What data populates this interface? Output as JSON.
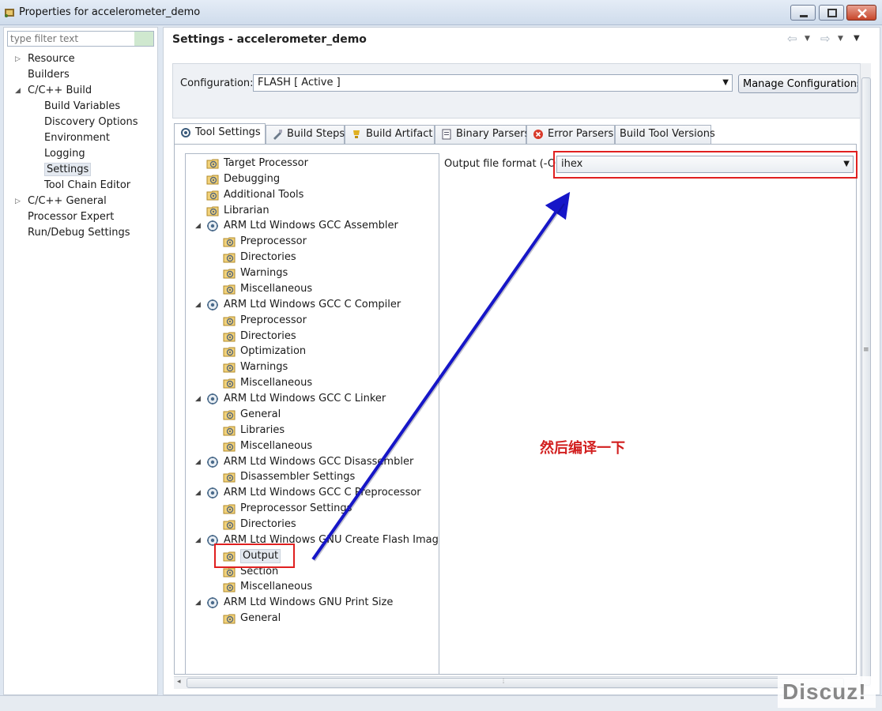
{
  "window": {
    "title": "Properties for accelerometer_demo",
    "icon": "eclipse-plugin-icon"
  },
  "filter": {
    "placeholder": "type filter text"
  },
  "sidebar": {
    "items": [
      {
        "label": "Resource",
        "twisty": "▷"
      },
      {
        "label": "Builders",
        "twisty": ""
      },
      {
        "label": "C/C++ Build",
        "twisty": "◢"
      },
      {
        "label": "Build Variables",
        "twisty": ""
      },
      {
        "label": "Discovery Options",
        "twisty": ""
      },
      {
        "label": "Environment",
        "twisty": ""
      },
      {
        "label": "Logging",
        "twisty": ""
      },
      {
        "label": "Settings",
        "twisty": ""
      },
      {
        "label": "Tool Chain Editor",
        "twisty": ""
      },
      {
        "label": "C/C++ General",
        "twisty": "▷"
      },
      {
        "label": "Processor Expert",
        "twisty": ""
      },
      {
        "label": "Run/Debug Settings",
        "twisty": ""
      }
    ]
  },
  "page": {
    "title": "Settings - accelerometer_demo"
  },
  "configuration": {
    "label": "Configuration:",
    "value": "FLASH  [ Active ]",
    "manage_label": "Manage Configurations..."
  },
  "tabs": [
    {
      "label": "Tool Settings",
      "icon": "tool-settings-icon"
    },
    {
      "label": "Build Steps",
      "icon": "build-steps-icon"
    },
    {
      "label": "Build Artifact",
      "icon": "build-artifact-icon"
    },
    {
      "label": "Binary Parsers",
      "icon": "binary-parsers-icon"
    },
    {
      "label": "Error Parsers",
      "icon": "error-parsers-icon"
    },
    {
      "label": "Build Tool Versions",
      "icon": ""
    }
  ],
  "tree": [
    {
      "label": "Target Processor",
      "level": 0,
      "kind": "folder",
      "expand": ""
    },
    {
      "label": "Debugging",
      "level": 0,
      "kind": "folder",
      "expand": ""
    },
    {
      "label": "Additional Tools",
      "level": 0,
      "kind": "folder",
      "expand": ""
    },
    {
      "label": "Librarian",
      "level": 0,
      "kind": "folder",
      "expand": ""
    },
    {
      "label": "ARM Ltd Windows GCC Assembler",
      "level": 0,
      "kind": "tool",
      "expand": "◢"
    },
    {
      "label": "Preprocessor",
      "level": 1,
      "kind": "folder",
      "expand": ""
    },
    {
      "label": "Directories",
      "level": 1,
      "kind": "folder",
      "expand": ""
    },
    {
      "label": "Warnings",
      "level": 1,
      "kind": "folder",
      "expand": ""
    },
    {
      "label": "Miscellaneous",
      "level": 1,
      "kind": "folder",
      "expand": ""
    },
    {
      "label": "ARM Ltd Windows GCC C Compiler",
      "level": 0,
      "kind": "tool",
      "expand": "◢"
    },
    {
      "label": "Preprocessor",
      "level": 1,
      "kind": "folder",
      "expand": ""
    },
    {
      "label": "Directories",
      "level": 1,
      "kind": "folder",
      "expand": ""
    },
    {
      "label": "Optimization",
      "level": 1,
      "kind": "folder",
      "expand": ""
    },
    {
      "label": "Warnings",
      "level": 1,
      "kind": "folder",
      "expand": ""
    },
    {
      "label": "Miscellaneous",
      "level": 1,
      "kind": "folder",
      "expand": ""
    },
    {
      "label": "ARM Ltd Windows GCC C Linker",
      "level": 0,
      "kind": "tool",
      "expand": "◢"
    },
    {
      "label": "General",
      "level": 1,
      "kind": "folder",
      "expand": ""
    },
    {
      "label": "Libraries",
      "level": 1,
      "kind": "folder",
      "expand": ""
    },
    {
      "label": "Miscellaneous",
      "level": 1,
      "kind": "folder",
      "expand": ""
    },
    {
      "label": "ARM Ltd Windows GCC Disassembler",
      "level": 0,
      "kind": "tool",
      "expand": "◢"
    },
    {
      "label": "Disassembler Settings",
      "level": 1,
      "kind": "folder",
      "expand": ""
    },
    {
      "label": "ARM Ltd Windows GCC C Preprocessor",
      "level": 0,
      "kind": "tool",
      "expand": "◢"
    },
    {
      "label": "Preprocessor Settings",
      "level": 1,
      "kind": "folder",
      "expand": ""
    },
    {
      "label": "Directories",
      "level": 1,
      "kind": "folder",
      "expand": ""
    },
    {
      "label": "ARM Ltd Windows GNU Create Flash Image",
      "level": 0,
      "kind": "tool",
      "expand": "◢"
    },
    {
      "label": "Output",
      "level": 1,
      "kind": "folder",
      "expand": "",
      "selected": true
    },
    {
      "label": "Section",
      "level": 1,
      "kind": "folder",
      "expand": ""
    },
    {
      "label": "Miscellaneous",
      "level": 1,
      "kind": "folder",
      "expand": ""
    },
    {
      "label": "ARM Ltd Windows GNU Print Size",
      "level": 0,
      "kind": "tool",
      "expand": "◢"
    },
    {
      "label": "General",
      "level": 1,
      "kind": "folder",
      "expand": ""
    }
  ],
  "output_format": {
    "label": "Output file format (-O)",
    "value": "ihex"
  },
  "annotation": {
    "text": "然后编译一下",
    "color": "#d21f1f"
  },
  "watermark": {
    "text": "Discuz!"
  },
  "colors": {
    "highlight": "#e02020",
    "arrow": "#1616c8"
  }
}
